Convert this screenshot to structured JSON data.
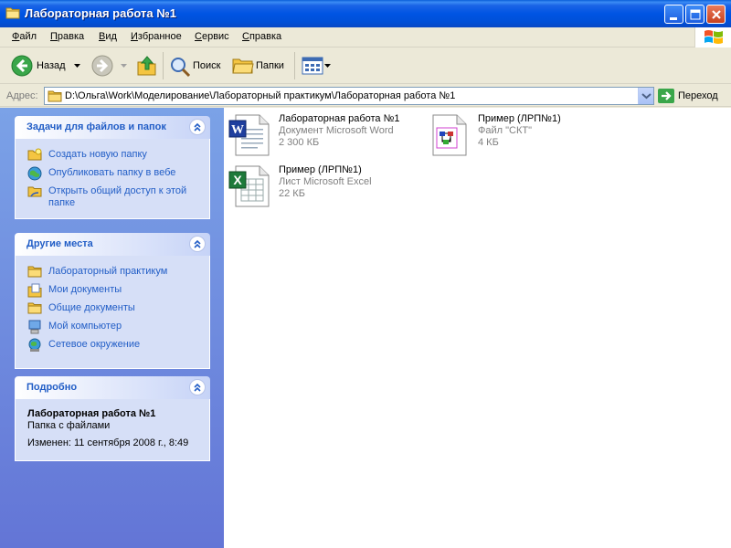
{
  "window": {
    "title": "Лабораторная работа №1"
  },
  "menu": [
    {
      "first": "Ф",
      "rest": "айл"
    },
    {
      "first": "П",
      "rest": "равка"
    },
    {
      "first": "В",
      "rest": "ид"
    },
    {
      "first": "И",
      "rest": "збранное"
    },
    {
      "first": "С",
      "rest": "ервис"
    },
    {
      "first": "С",
      "rest": "правка"
    }
  ],
  "toolbar": {
    "back_label": "Назад",
    "search_label": "Поиск",
    "folders_label": "Папки"
  },
  "address": {
    "label": "Адрес:",
    "path": "D:\\Ольга\\Work\\Моделирование\\Лабораторный практикум\\Лабораторная работа №1",
    "go_label": "Переход"
  },
  "tasks": {
    "title": "Задачи для файлов и папок",
    "items": [
      {
        "label": "Создать новую папку"
      },
      {
        "label": "Опубликовать папку в вебе"
      },
      {
        "label": "Открыть общий доступ к этой папке"
      }
    ]
  },
  "places": {
    "title": "Другие места",
    "items": [
      {
        "label": "Лабораторный практикум"
      },
      {
        "label": "Мои документы"
      },
      {
        "label": "Общие документы"
      },
      {
        "label": "Мой компьютер"
      },
      {
        "label": "Сетевое окружение"
      }
    ]
  },
  "details": {
    "title": "Подробно",
    "name": "Лабораторная работа №1",
    "type": "Папка с файлами",
    "modified": "Изменен: 11 сентября 2008 г., 8:49"
  },
  "files": [
    {
      "name": "Лабораторная работа №1",
      "type": "Документ Microsoft Word",
      "size": "2 300 КБ"
    },
    {
      "name": "Пример (ЛРП№1)",
      "type": "Файл \"СКТ\"",
      "size": "4 КБ"
    },
    {
      "name": "Пример (ЛРП№1)",
      "type": "Лист Microsoft Excel",
      "size": "22 КБ"
    }
  ],
  "colors": {
    "titlebar": "#0054e3",
    "taskpane": "#7ba2e7",
    "link": "#215dc6"
  }
}
